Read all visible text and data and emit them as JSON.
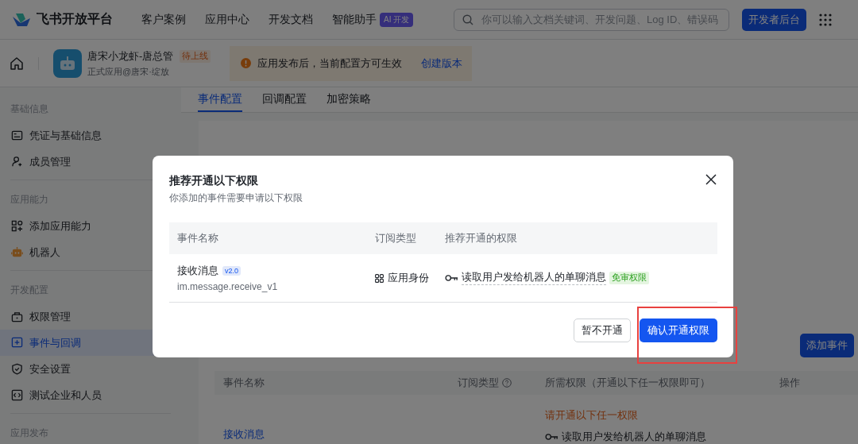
{
  "header": {
    "logo_text": "飞书开放平台",
    "nav": [
      {
        "label": "客户案例"
      },
      {
        "label": "应用中心"
      },
      {
        "label": "开发文档"
      },
      {
        "label": "智能助手"
      }
    ],
    "ai_badge": "AI 开发",
    "search": {
      "placeholder": "你可以输入文档关键词、开发问题、Log ID、错误码"
    },
    "console_button": "开发者后台"
  },
  "app_bar": {
    "app_name": "唐宋小龙虾-唐总管",
    "status_tag": "待上线",
    "subtitle": "正式应用@唐宋·绽放",
    "notice": "应用发布后，当前配置方可生效",
    "notice_link": "创建版本"
  },
  "sidebar": {
    "sections": [
      {
        "title": "基础信息",
        "items": [
          {
            "label": "凭证与基础信息",
            "kind": "credential",
            "selected": false
          },
          {
            "label": "成员管理",
            "kind": "member",
            "selected": false
          }
        ]
      },
      {
        "title": "应用能力",
        "items": [
          {
            "label": "添加应用能力",
            "kind": "apps",
            "selected": false
          },
          {
            "label": "机器人",
            "kind": "robot",
            "selected": false
          }
        ]
      },
      {
        "title": "开发配置",
        "items": [
          {
            "label": "权限管理",
            "kind": "lock",
            "selected": false
          },
          {
            "label": "事件与回调",
            "kind": "event",
            "selected": true
          },
          {
            "label": "安全设置",
            "kind": "shield",
            "selected": false
          },
          {
            "label": "测试企业和人员",
            "kind": "code",
            "selected": false
          }
        ]
      },
      {
        "title": "应用发布"
      }
    ]
  },
  "tabs": [
    {
      "label": "事件配置",
      "selected": true
    },
    {
      "label": "回调配置",
      "selected": false
    },
    {
      "label": "加密策略",
      "selected": false
    }
  ],
  "event_card": {
    "add_button": "添加事件",
    "columns": [
      "事件名称",
      "订阅类型",
      "所需权限（开通以下任一权限即可）",
      "操作"
    ],
    "rows": [
      {
        "status": "请开通以下任一权限",
        "name": "接收消息",
        "permission": "读取用户发给机器人的单聊消息"
      }
    ]
  },
  "modal": {
    "title": "推荐开通以下权限",
    "subtitle": "你添加的事件需要申请以下权限",
    "columns": [
      "事件名称",
      "订阅类型",
      "推荐开通的权限"
    ],
    "rows": [
      {
        "name": "接收消息",
        "version": "v2.0",
        "event_key": "im.message.receive_v1",
        "subscription": "应用身份",
        "permission": "读取用户发给机器人的单聊消息",
        "permission_tag": "免审权限"
      }
    ],
    "cancel_button": "暂不开通",
    "confirm_button": "确认开通权限"
  }
}
